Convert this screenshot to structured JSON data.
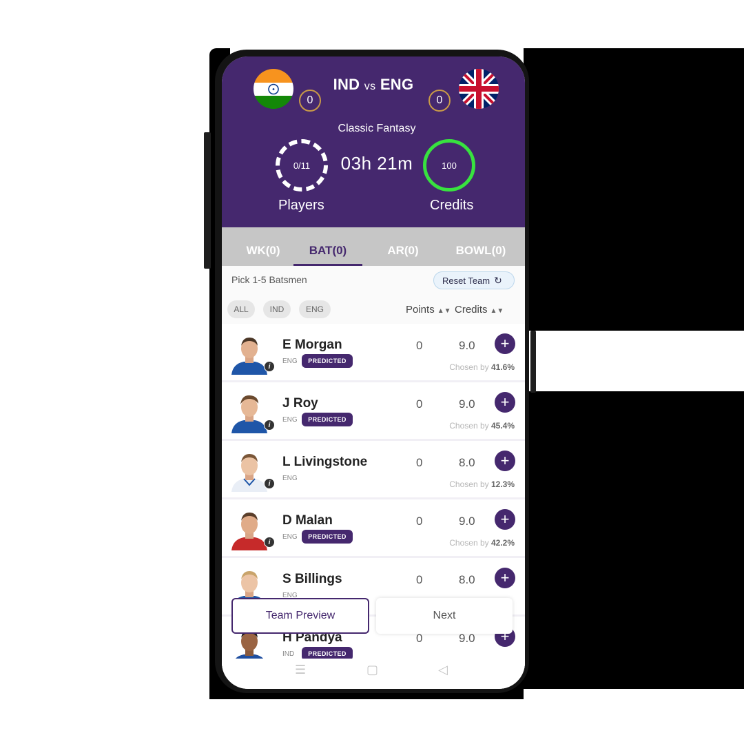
{
  "match": {
    "team_left": "IND",
    "vs": "vs",
    "team_right": "ENG",
    "score_left": "0",
    "score_right": "0",
    "mode": "Classic Fantasy",
    "timer": "03h 21m",
    "players_count": "0/11",
    "players_label": "Players",
    "credits_value": "100",
    "credits_label": "Credits"
  },
  "tabs": [
    {
      "label": "WK(0)",
      "active": false
    },
    {
      "label": "BAT(0)",
      "active": true
    },
    {
      "label": "AR(0)",
      "active": false
    },
    {
      "label": "BOWL(0)",
      "active": false
    }
  ],
  "toolbar": {
    "pick_text": "Pick 1-5 Batsmen",
    "reset_label": "Reset Team",
    "filters": [
      "ALL",
      "IND",
      "ENG"
    ],
    "sort_points": "Points",
    "sort_credits": "Credits"
  },
  "players": [
    {
      "name": "E Morgan",
      "team": "ENG",
      "predicted": "PREDICTED",
      "points": "0",
      "credits": "9.0",
      "chosen_label": "Chosen by",
      "chosen_pct": "41.6%"
    },
    {
      "name": "J Roy",
      "team": "ENG",
      "predicted": "PREDICTED",
      "points": "0",
      "credits": "9.0",
      "chosen_label": "Chosen by",
      "chosen_pct": "45.4%"
    },
    {
      "name": "L Livingstone",
      "team": "ENG",
      "predicted": "",
      "points": "0",
      "credits": "8.0",
      "chosen_label": "Chosen by",
      "chosen_pct": "12.3%"
    },
    {
      "name": "D Malan",
      "team": "ENG",
      "predicted": "PREDICTED",
      "points": "0",
      "credits": "9.0",
      "chosen_label": "Chosen by",
      "chosen_pct": "42.2%"
    },
    {
      "name": "S Billings",
      "team": "ENG",
      "predicted": "",
      "points": "0",
      "credits": "8.0",
      "chosen_label": "",
      "chosen_pct": ""
    },
    {
      "name": "H Pandya",
      "team": "IND",
      "predicted": "PREDICTED",
      "points": "0",
      "credits": "9.0",
      "chosen_label": "",
      "chosen_pct": ""
    }
  ],
  "actions": {
    "team_preview": "Team Preview",
    "next": "Next"
  },
  "colors": {
    "brand_purple": "#45286e",
    "credits_ring": "#38e23f",
    "score_ring": "#c99a47"
  }
}
